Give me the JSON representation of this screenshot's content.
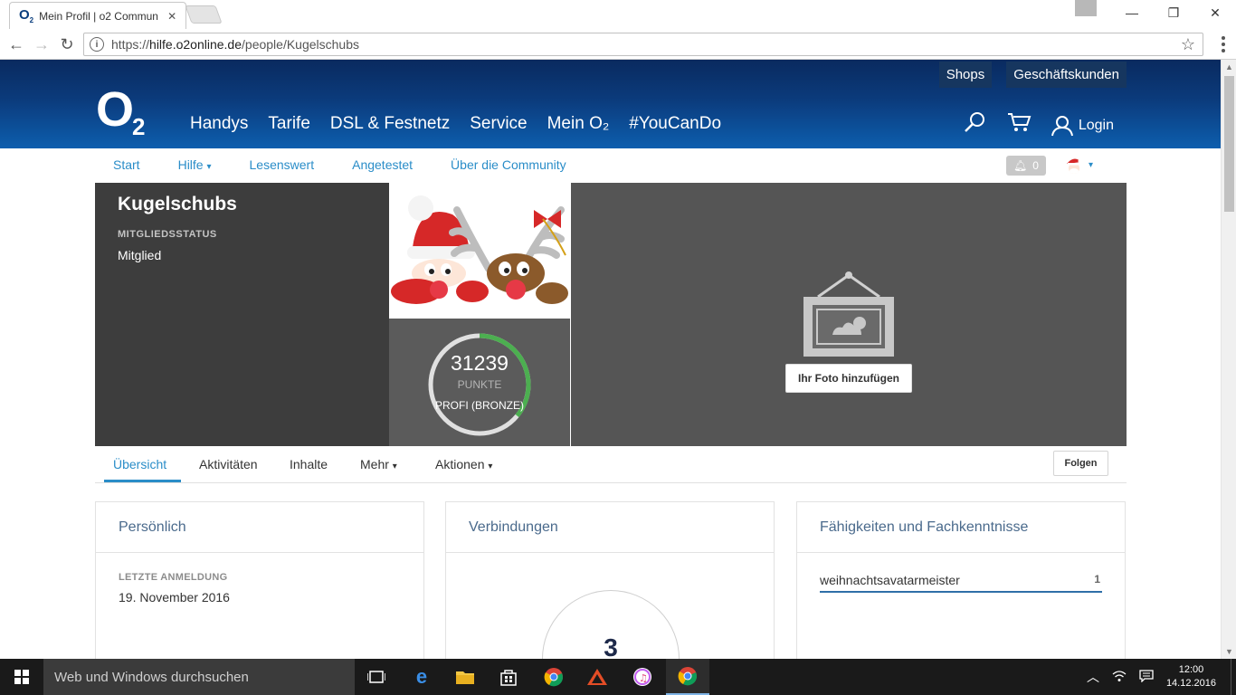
{
  "browser": {
    "tab_title": "Mein Profil | o2 Commun",
    "url_prefix": "https://",
    "url_host": "hilfe.o2online.de",
    "url_path": "/people/Kugelschubs"
  },
  "site": {
    "top_links": [
      "Shops",
      "Geschäftskunden"
    ],
    "logo": "O",
    "logo_sub": "2",
    "nav": [
      "Handys",
      "Tarife",
      "DSL & Festnetz",
      "Service",
      "Mein O₂",
      "#YouCanDo"
    ],
    "login_label": "Login"
  },
  "subnav": {
    "items": [
      "Start",
      "Hilfe",
      "Lesenswert",
      "Angetestet",
      "Über die Community"
    ],
    "notification_count": "0"
  },
  "profile": {
    "username": "Kugelschubs",
    "status_label": "MITGLIEDSSTATUS",
    "status_value": "Mitglied",
    "points": "31239",
    "points_unit": "PUNKTE",
    "rank": "PROFI (BRONZE)",
    "rank_progress": 0.36,
    "add_photo_label": "Ihr Foto hinzufügen"
  },
  "tabs": {
    "items": [
      "Übersicht",
      "Aktivitäten",
      "Inhalte",
      "Mehr",
      "Aktionen"
    ],
    "active": "Übersicht",
    "follow_label": "Folgen"
  },
  "cards": {
    "personal": {
      "title": "Persönlich",
      "last_login_label": "LETZTE ANMELDUNG",
      "last_login_value": "19. November 2016"
    },
    "connections": {
      "title": "Verbindungen",
      "count": "3"
    },
    "skills": {
      "title": "Fähigkeiten und Fachkenntnisse",
      "items": [
        {
          "name": "weihnachtsavatarmeister",
          "count": "1"
        }
      ]
    }
  },
  "taskbar": {
    "search_placeholder": "Web und Windows durchsuchen",
    "time": "12:00",
    "date": "14.12.2016"
  },
  "colors": {
    "brand_blue": "#0b3b7c",
    "link_blue": "#2a8dc8",
    "ring_green": "#4caf50"
  }
}
